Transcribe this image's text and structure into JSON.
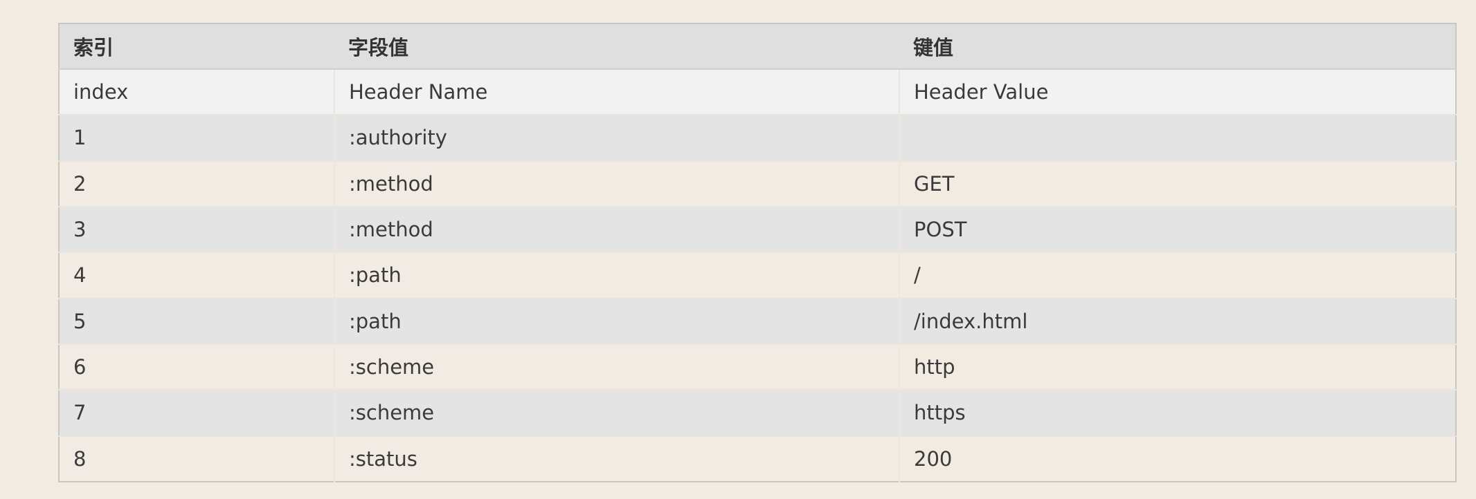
{
  "table": {
    "header": {
      "col_index": "索引",
      "col_name": "字段值",
      "col_value": "键值"
    },
    "sub_header": {
      "index": "index",
      "name": "Header Name",
      "value": "Header Value"
    },
    "rows": [
      {
        "index": "1",
        "name": ":authority",
        "value": ""
      },
      {
        "index": "2",
        "name": ":method",
        "value": "GET"
      },
      {
        "index": "3",
        "name": ":method",
        "value": "POST"
      },
      {
        "index": "4",
        "name": ":path",
        "value": "/"
      },
      {
        "index": "5",
        "name": ":path",
        "value": "/index.html"
      },
      {
        "index": "6",
        "name": ":scheme",
        "value": "http"
      },
      {
        "index": "7",
        "name": ":scheme",
        "value": "https"
      },
      {
        "index": "8",
        "name": ":status",
        "value": "200"
      }
    ]
  },
  "colors": {
    "page_background": "#f1ebe2",
    "header_background": "#dfdfdf",
    "sub_header_background": "#f2f2f2",
    "striped_row_background": "#e4e4e4",
    "plain_row_background": "#f2ebe2",
    "border": "#c9c6c1"
  }
}
